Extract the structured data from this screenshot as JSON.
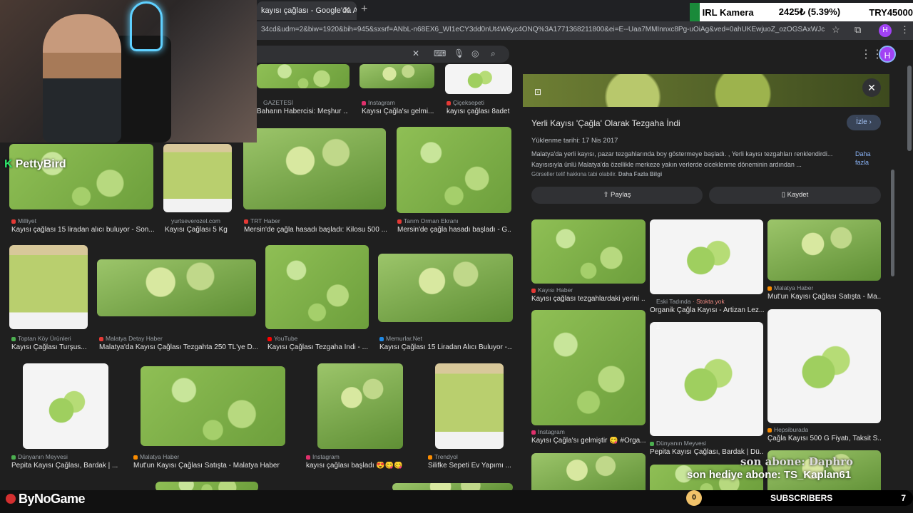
{
  "browser": {
    "tab_title": "kayısı çağlası - Google'da Ara",
    "tab_close": "✕",
    "new_tab": "+",
    "url": "34cd&udm=2&biw=1920&bih=945&sxsrf=ANbL-n68EX6_WI1eCY3dd0nUt4W6yc4ONQ%3A1771368211800&ei=E--Uaa7MMInnxc8Pg-uOiAg&ved=0ahUKEwjuoZ_ozOGSAxWJc_EDHYO1A4E...",
    "profile_letter": "H"
  },
  "ticker": {
    "name": "IRL Kamera",
    "price": "2425₺ (5.39%)",
    "goal": "TRY45000"
  },
  "search": {
    "clear": "✕",
    "account_letter": "H"
  },
  "results": [
    {
      "source": "GAZETESİ",
      "title": "Baharın Habercisi: Meşhur ...",
      "fav": "#9aa0a6"
    },
    {
      "source": "Instagram",
      "title": "Kayısı Çağla'sı gelmi...",
      "fav": "#e1306c"
    },
    {
      "source": "Çiçeksepeti",
      "title": "kayısı çağlası 8adet",
      "fav": "#e53935"
    },
    {
      "source": "Milliyet",
      "title": "Kayısı çağlası 15 liradan alıcı buluyor - Son...",
      "fav": "#e53935"
    },
    {
      "source": "yurtseverozel.com",
      "title": "Kayısı Çağlası 5 Kg",
      "fav": "#9aa0a6"
    },
    {
      "source": "TRT Haber",
      "title": "Mersin'de çağla hasadı başladı: Kilosu 500 ...",
      "fav": "#e53935"
    },
    {
      "source": "Tarım Orman Ekranı",
      "title": "Mersin'de çağla hasadı başladı - G...",
      "fav": "#e53935"
    },
    {
      "source": "Toptan Köy Ürünleri",
      "title": "Kayısı Çağlası Turşus...",
      "fav": "#4caf50"
    },
    {
      "source": "Malatya Detay Haber",
      "title": "Malatya'da Kayısı Çağlası Tezgahta 250 TL'ye D...",
      "fav": "#e53935"
    },
    {
      "source": "YouTube",
      "title": "Kayısı Çağlası Tezgaha İndi - ...",
      "fav": "#ff0000"
    },
    {
      "source": "Memurlar.Net",
      "title": "Kayısı Çağlası 15 Liradan Alıcı Buluyor -...",
      "fav": "#1e88e5"
    },
    {
      "source": "Dünyanın Meyvesi",
      "title": "Pepita Kayısı Çağlası, Bardak | ...",
      "fav": "#4caf50"
    },
    {
      "source": "Malatya Haber",
      "title": "Mut'un Kayısı Çağlası Satışta - Malatya Haber",
      "fav": "#fb8c00"
    },
    {
      "source": "Instagram",
      "title": "kayısı çağlası başladı 😍😋😋",
      "fav": "#e1306c"
    },
    {
      "source": "Trendyol",
      "title": "Silifke Sepeti Ev Yapımı ...",
      "fav": "#fb8c00"
    }
  ],
  "panel": {
    "title": "Yerli Kayısı 'Çağla' Olarak Tezgaha İndi",
    "watch": "İzle",
    "date": "Yüklenme tarihi: 17 Nis 2017",
    "desc1": "Malatya'da yerli kayısı, pazar tezgahlarında boy göstermeye başladı. , Yerli kayısı tezgahları renklendirdi...",
    "desc2": "Kayısısıyla ünlü Malatya'da özellikle merkeze yakın verlerde ciceklenme döneminin ardından ...",
    "more": "Daha fazla",
    "copyright": "Görseller telif hakkına tabi olabilir.",
    "copyright_link": "Daha Fazla Bilgi",
    "share": "Paylaş",
    "save": "Kaydet",
    "related": [
      {
        "source": "Kayısı Haber",
        "title": "Kayısı çağlası tezgahlardaki yerini ...",
        "fav": "#e53935",
        "extra": ""
      },
      {
        "source": "Eski Tadında",
        "title": "Organik Çağla Kayısı - Artizan Lez...",
        "fav": "#9aa0a6",
        "extra": "· Stokta yok"
      },
      {
        "source": "Malatya Haber",
        "title": "Mut'un Kayısı Çağlası Satışta - Ma...",
        "fav": "#fb8c00",
        "extra": ""
      },
      {
        "source": "Instagram",
        "title": "Kayısı Çağla'sı gelmiştir 😋 #Orga...",
        "fav": "#e1306c",
        "extra": ""
      },
      {
        "source": "Dünyanın Meyvesi",
        "title": "Pepita Kayısı Çağlası, Bardak | Dü...",
        "fav": "#4caf50",
        "extra": ""
      },
      {
        "source": "Hepsiburada",
        "title": "Çağla Kayısı 500 G Fiyatı, Taksit S...",
        "fav": "#fb8c00",
        "extra": ""
      }
    ]
  },
  "overlay": {
    "streamer_tag": "PettyBird",
    "brand": "ByNoGame",
    "subscribers_label": "SUBSCRIBERS",
    "subscribers_count": "0",
    "subscribers_goal": "7",
    "alert_sub": "son abone: Daphro",
    "alert_gift": "son hediye abone: TS_Kaplan61"
  }
}
